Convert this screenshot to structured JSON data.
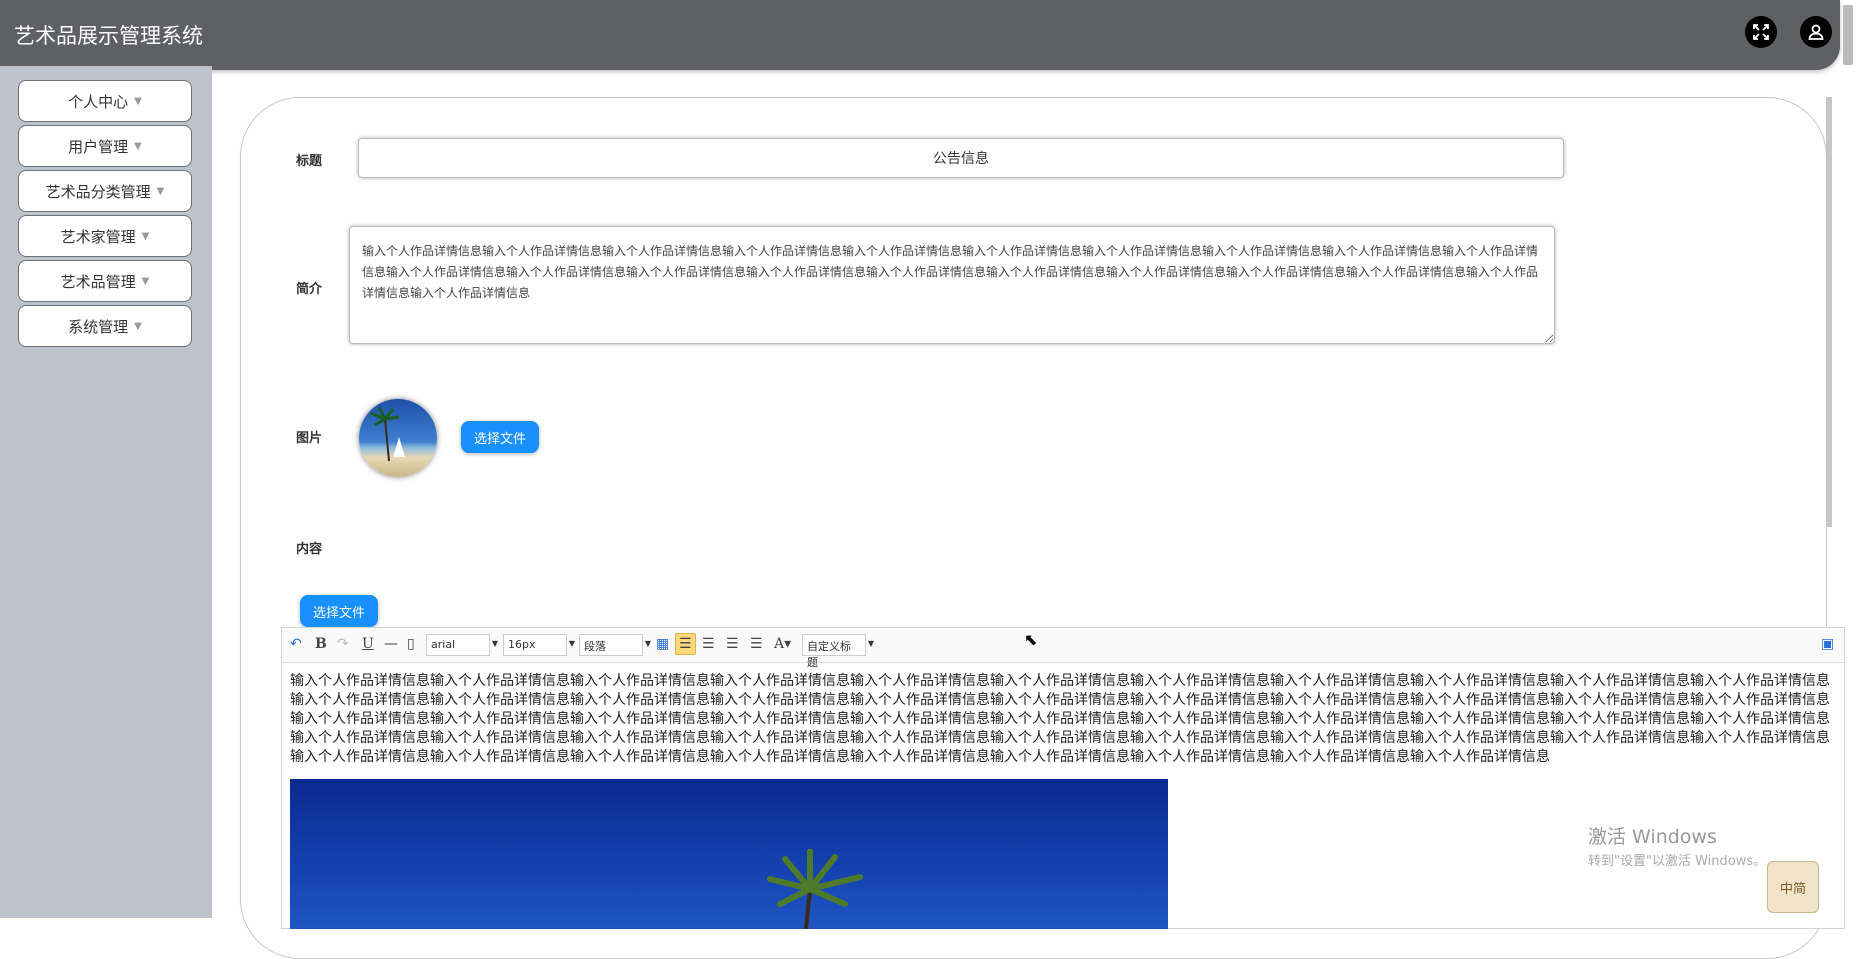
{
  "header": {
    "title": "艺术品展示管理系统",
    "fullscreen_icon": "expand-icon",
    "user_icon": "user-icon"
  },
  "sidebar": {
    "items": [
      {
        "label": "个人中心"
      },
      {
        "label": "用户管理"
      },
      {
        "label": "艺术品分类管理"
      },
      {
        "label": "艺术家管理"
      },
      {
        "label": "艺术品管理"
      },
      {
        "label": "系统管理"
      }
    ]
  },
  "form": {
    "title_label": "标题",
    "title_value": "公告信息",
    "intro_label": "简介",
    "intro_value": "输入个人作品详情信息输入个人作品详情信息输入个人作品详情信息输入个人作品详情信息输入个人作品详情信息输入个人作品详情信息输入个人作品详情信息输入个人作品详情信息输入个人作品详情信息输入个人作品详情信息输入个人作品详情信息输入个人作品详情信息输入个人作品详情信息输入个人作品详情信息输入个人作品详情信息输入个人作品详情信息输入个人作品详情信息输入个人作品详情信息输入个人作品详情信息输入个人作品详情信息输入个人作品详情信息",
    "image_label": "图片",
    "choose_file_label": "选择文件",
    "content_label": "内容",
    "content_choose_file_label": "选择文件"
  },
  "editor": {
    "toolbar": {
      "font_family": "arial",
      "font_size": "16px",
      "paragraph": "段落",
      "custom_title": "自定义标题"
    },
    "body_text": "输入个人作品详情信息输入个人作品详情信息输入个人作品详情信息输入个人作品详情信息输入个人作品详情信息输入个人作品详情信息输入个人作品详情信息输入个人作品详情信息输入个人作品详情信息输入个人作品详情信息输入个人作品详情信息输入个人作品详情信息输入个人作品详情信息输入个人作品详情信息输入个人作品详情信息输入个人作品详情信息输入个人作品详情信息输入个人作品详情信息输入个人作品详情信息输入个人作品详情信息输入个人作品详情信息输入个人作品详情信息输入个人作品详情信息输入个人作品详情信息输入个人作品详情信息输入个人作品详情信息输入个人作品详情信息输入个人作品详情信息输入个人作品详情信息输入个人作品详情信息输入个人作品详情信息输入个人作品详情信息输入个人作品详情信息输入个人作品详情信息输入个人作品详情信息输入个人作品详情信息输入个人作品详情信息输入个人作品详情信息输入个人作品详情信息输入个人作品详情信息输入个人作品详情信息输入个人作品详情信息输入个人作品详情信息输入个人作品详情信息输入个人作品详情信息输入个人作品详情信息输入个人作品详情信息输入个人作品详情信息输入个人作品详情信息输入个人作品详情信息输入个人作品详情信息输入个人作品详情信息输入个人作品详情信息"
  },
  "overlay": {
    "watermark": "激活 Windows",
    "watermark_sub": "转到\"设置\"以激活 Windows。",
    "ime_label": "中简"
  }
}
